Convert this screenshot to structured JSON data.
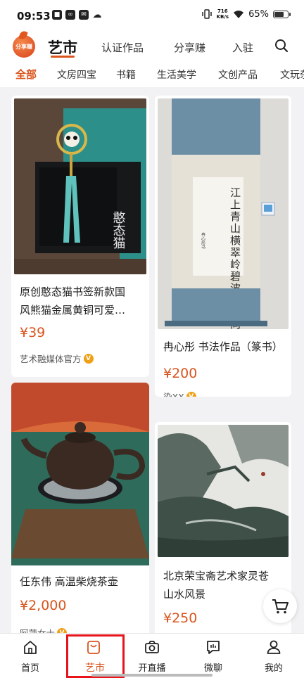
{
  "status_bar": {
    "time": "09:53",
    "speed_value": "716",
    "speed_unit": "KB/s",
    "battery": "65%"
  },
  "header": {
    "logo_text": "分享赚",
    "main_tab": "艺市",
    "tabs": [
      "认证作品",
      "分享赚",
      "入驻"
    ]
  },
  "categories": [
    "全部",
    "文房四宝",
    "书籍",
    "生活美学",
    "文创产品",
    "文玩杂"
  ],
  "products": [
    {
      "title_line1": "原创憨态猫书签新款国",
      "title_line2": "风熊猫金属黄铜可爱…",
      "price": "¥39",
      "seller": "艺术融媒体官方"
    },
    {
      "title_line1": "冉心彤 书法作品（篆书）",
      "price": "¥200",
      "seller": "染XX"
    },
    {
      "title_line1": "任东伟 高温柴烧茶壶",
      "price": "¥2,000",
      "seller": "阿萍女士"
    },
    {
      "title_line1": "北京荣宝斋艺术家灵苍",
      "title_line2": "山水风景",
      "price": "¥250",
      "seller": ""
    }
  ],
  "product_art": {
    "bookmark_box_label": "憨态猫",
    "calligraphy_text": "江上青山横翠岭碧波一曲向东流",
    "calligraphy_signature": "冉心彤书"
  },
  "bottom_nav": [
    "首页",
    "艺市",
    "开直播",
    "微聊",
    "我的"
  ],
  "colors": {
    "accent": "#d9541e",
    "highlight_outline": "#e8141b",
    "verified_badge": "#f0a014"
  }
}
